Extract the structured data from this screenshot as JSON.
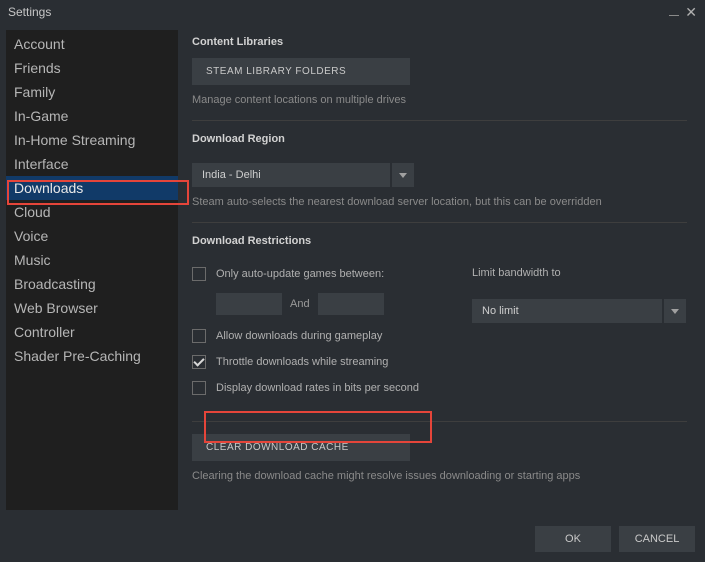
{
  "window": {
    "title": "Settings"
  },
  "sidebar": {
    "items": [
      {
        "label": "Account"
      },
      {
        "label": "Friends"
      },
      {
        "label": "Family"
      },
      {
        "label": "In-Game"
      },
      {
        "label": "In-Home Streaming"
      },
      {
        "label": "Interface"
      },
      {
        "label": "Downloads",
        "active": true
      },
      {
        "label": "Cloud"
      },
      {
        "label": "Voice"
      },
      {
        "label": "Music"
      },
      {
        "label": "Broadcasting"
      },
      {
        "label": "Web Browser"
      },
      {
        "label": "Controller"
      },
      {
        "label": "Shader Pre-Caching"
      }
    ]
  },
  "content_libraries": {
    "title": "Content Libraries",
    "button": "STEAM LIBRARY FOLDERS",
    "helper": "Manage content locations on multiple drives"
  },
  "download_region": {
    "title": "Download Region",
    "value": "India - Delhi",
    "helper": "Steam auto-selects the nearest download server location, but this can be overridden"
  },
  "restrictions": {
    "title": "Download Restrictions",
    "auto_update_label": "Only auto-update games between:",
    "and_label": "And",
    "allow_gameplay_label": "Allow downloads during gameplay",
    "throttle_label": "Throttle downloads while streaming",
    "display_bits_label": "Display download rates in bits per second",
    "limit_label": "Limit bandwidth to",
    "limit_value": "No limit"
  },
  "cache": {
    "button": "CLEAR DOWNLOAD CACHE",
    "helper": "Clearing the download cache might resolve issues downloading or starting apps"
  },
  "footer": {
    "ok": "OK",
    "cancel": "CANCEL"
  }
}
